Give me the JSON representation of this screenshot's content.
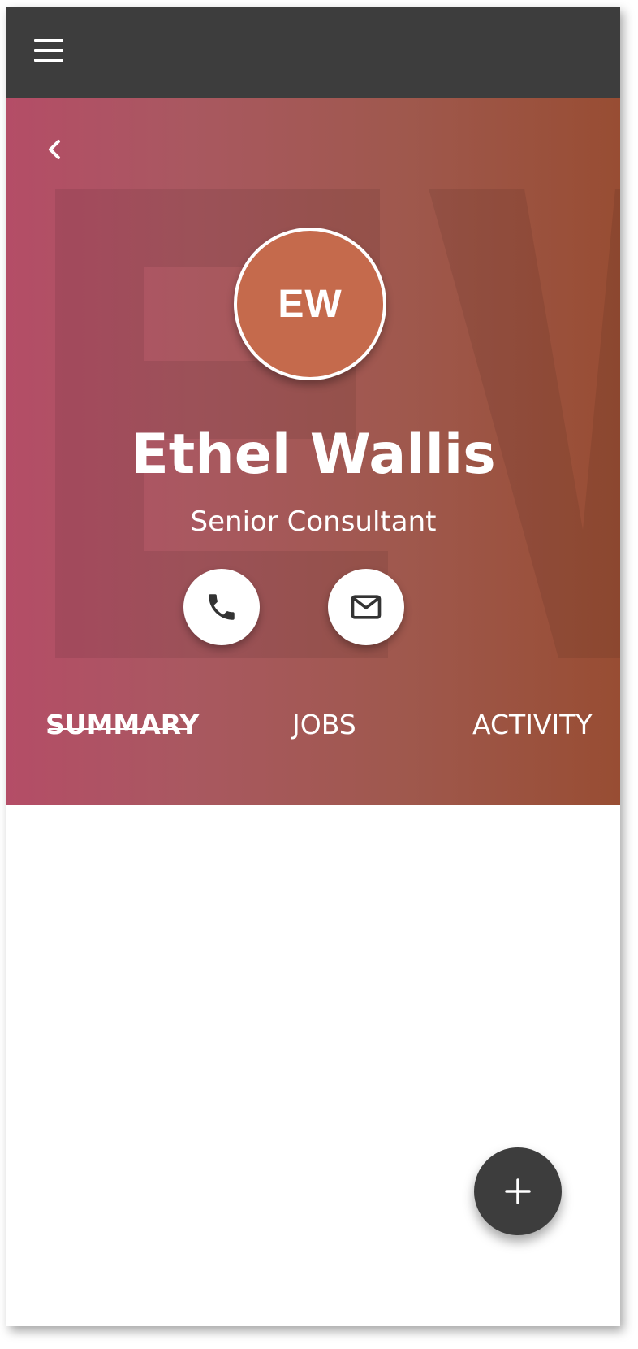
{
  "header": {
    "menu_icon": "hamburger-menu-icon"
  },
  "profile": {
    "back_icon": "chevron-left-icon",
    "initials": "EW",
    "name": "Ethel Wallis",
    "job_title": "Senior Consultant",
    "actions": {
      "phone_icon": "phone-icon",
      "email_icon": "mail-icon"
    }
  },
  "tabs": [
    {
      "label": "SUMMARY",
      "active": true
    },
    {
      "label": "JOBS",
      "active": false
    },
    {
      "label": "ACTIVITY",
      "active": false
    }
  ],
  "fab": {
    "icon": "plus-icon"
  },
  "colors": {
    "appbar": "#3d3d3d",
    "avatar": "#c56a4c",
    "gradient_start": "#b84f6a",
    "gradient_end": "#9c4f35",
    "fab": "#3d3d3d"
  }
}
